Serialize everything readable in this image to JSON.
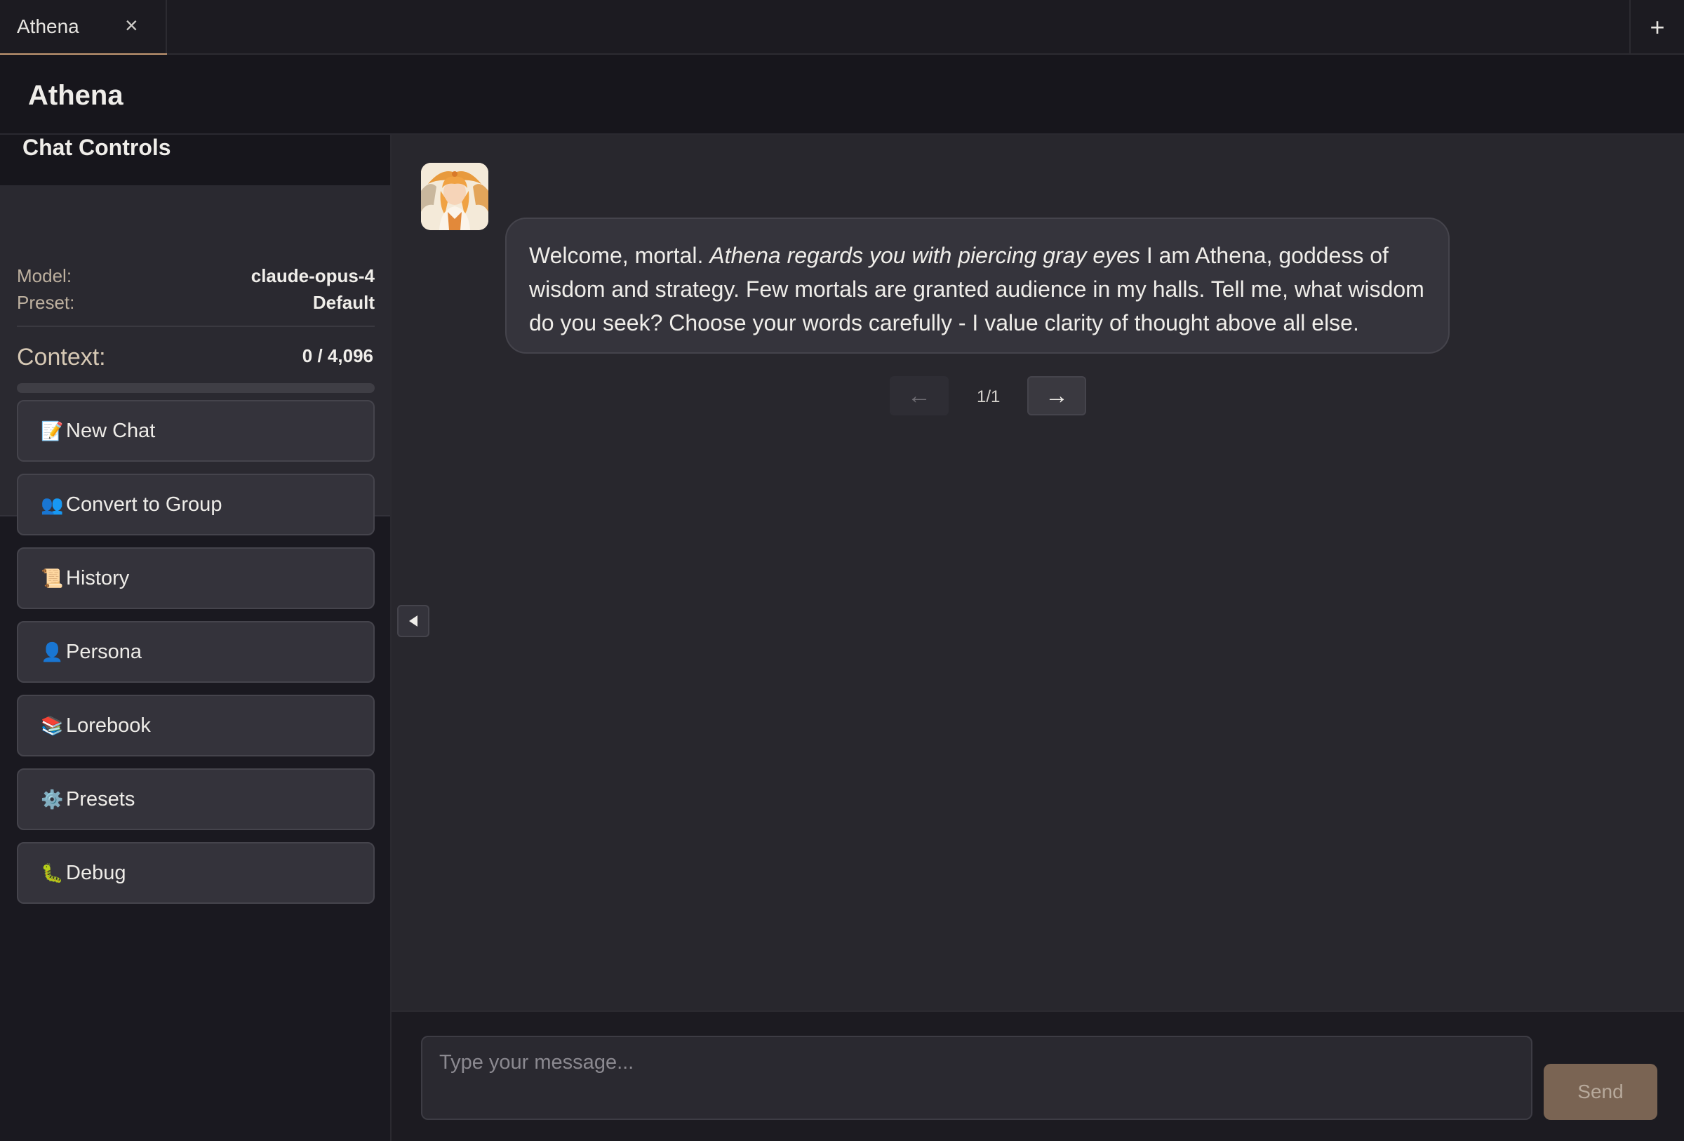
{
  "tabs": [
    {
      "label": "Athena",
      "close_symbol": "×"
    }
  ],
  "new_tab_symbol": "+",
  "header": {
    "title": "Athena"
  },
  "sidebar": {
    "title": "Chat Controls",
    "model_label": "Model:",
    "model_value": "claude-opus-4",
    "preset_label": "Preset:",
    "preset_value": "Default",
    "context_label": "Context:",
    "context_value": "0 / 4,096",
    "context_fraction": 0,
    "context_percent": "0%",
    "buttons": [
      {
        "icon": "📝",
        "icon_name": "memo-icon",
        "label": "New Chat"
      },
      {
        "icon": "👥",
        "icon_name": "people-icon",
        "label": "Convert to Group"
      },
      {
        "icon": "📜",
        "icon_name": "scroll-icon",
        "label": "History"
      },
      {
        "icon": "👤",
        "icon_name": "person-icon",
        "label": "Persona"
      },
      {
        "icon": "📚",
        "icon_name": "books-icon",
        "label": "Lorebook"
      },
      {
        "icon": "⚙️",
        "icon_name": "gear-icon",
        "label": "Presets"
      },
      {
        "icon": "🐛",
        "icon_name": "bug-icon",
        "label": "Debug"
      }
    ]
  },
  "chat": {
    "message": {
      "text_before": "Welcome, mortal. ",
      "emphasis": "Athena regards you with piercing gray eyes",
      "text_after": " I am Athena, goddess of wisdom and strategy. Few mortals are granted audience in my halls. Tell me, what wisdom do you seek? Choose your words carefully - I value clarity of thought above all else."
    },
    "pager": {
      "prev": "←",
      "count": "1/1",
      "next": "→"
    }
  },
  "composer": {
    "placeholder": "Type your message...",
    "send_label": "Send"
  },
  "colors": {
    "accent": "#c59a73",
    "send_button": "#7a6453",
    "background": "#1c1b21",
    "chat_background": "#28272d"
  }
}
